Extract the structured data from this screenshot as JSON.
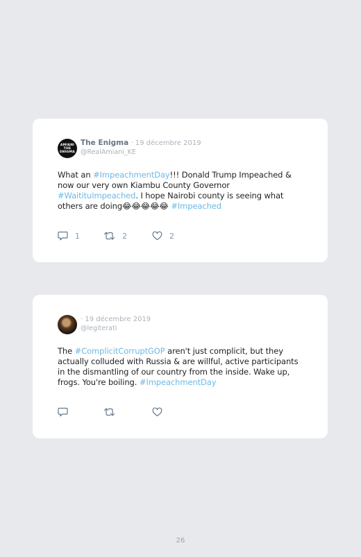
{
  "tweets": [
    {
      "avatar_text": "AMIANI THE ENIGMA",
      "name": "The Enigma",
      "date": "· 19 décembre 2019",
      "handle": "@RealAmiani_KE",
      "text": [
        {
          "t": "What an ",
          "h": false
        },
        {
          "t": "#ImpeachmentDay",
          "h": true
        },
        {
          "t": "!!! Donald Trump Impeached & now our very own Kiambu County Governor ",
          "h": false
        },
        {
          "t": "#WaitituImpeached",
          "h": true
        },
        {
          "t": ". I hope Nairobi county is seeing what others are doing😂😂😂😂😂 ",
          "h": false
        },
        {
          "t": "#Impeached",
          "h": true
        }
      ],
      "replies": "1",
      "retweets": "2",
      "likes": "2"
    },
    {
      "avatar_text": "",
      "name": "",
      "date": "· 19 décembre 2019",
      "handle": "@legiterati",
      "text": [
        {
          "t": "The ",
          "h": false
        },
        {
          "t": "#ComplicitCorruptGOP",
          "h": true
        },
        {
          "t": " aren't just complicit, but they actually colluded with Russia & are willful, active participants in the dismantling of our country from the inside. Wake up, frogs. You're boiling. ",
          "h": false
        },
        {
          "t": "#ImpeachmentDay",
          "h": true
        }
      ],
      "replies": "",
      "retweets": "",
      "likes": ""
    }
  ],
  "page_number": "26",
  "colors": {
    "hashtag": "#6db8e6",
    "background": "#e8e9ed",
    "card": "#ffffff"
  },
  "icons": [
    "reply-icon",
    "retweet-icon",
    "like-icon"
  ]
}
